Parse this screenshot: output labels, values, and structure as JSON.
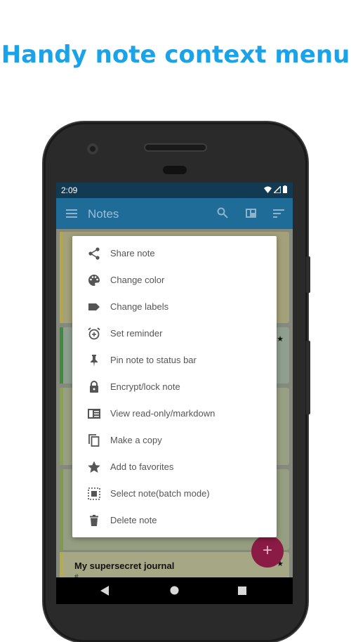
{
  "headline": "Handy note context menu",
  "status_bar": {
    "time": "2:09"
  },
  "toolbar": {
    "title": "Notes"
  },
  "menu": {
    "items": [
      {
        "label": "Share note",
        "icon": "share-icon"
      },
      {
        "label": "Change color",
        "icon": "palette-icon"
      },
      {
        "label": "Change labels",
        "icon": "label-icon"
      },
      {
        "label": "Set reminder",
        "icon": "alarm-add-icon"
      },
      {
        "label": "Pin note to status bar",
        "icon": "pin-icon"
      },
      {
        "label": "Encrypt/lock note",
        "icon": "lock-icon"
      },
      {
        "label": "View read-only/markdown",
        "icon": "read-view-icon"
      },
      {
        "label": "Make a copy",
        "icon": "copy-icon"
      },
      {
        "label": "Add to favorites",
        "icon": "star-icon"
      },
      {
        "label": "Select note(batch mode)",
        "icon": "select-icon"
      },
      {
        "label": "Delete note",
        "icon": "trash-icon"
      }
    ]
  },
  "notes": {
    "journal_title": "My supersecret journal",
    "journal_sub": "#..."
  },
  "fab": {
    "symbol": "+"
  },
  "colors": {
    "accent": "#1aa3e8",
    "toolbar": "#1e6c97",
    "fab": "#8a1b45"
  }
}
